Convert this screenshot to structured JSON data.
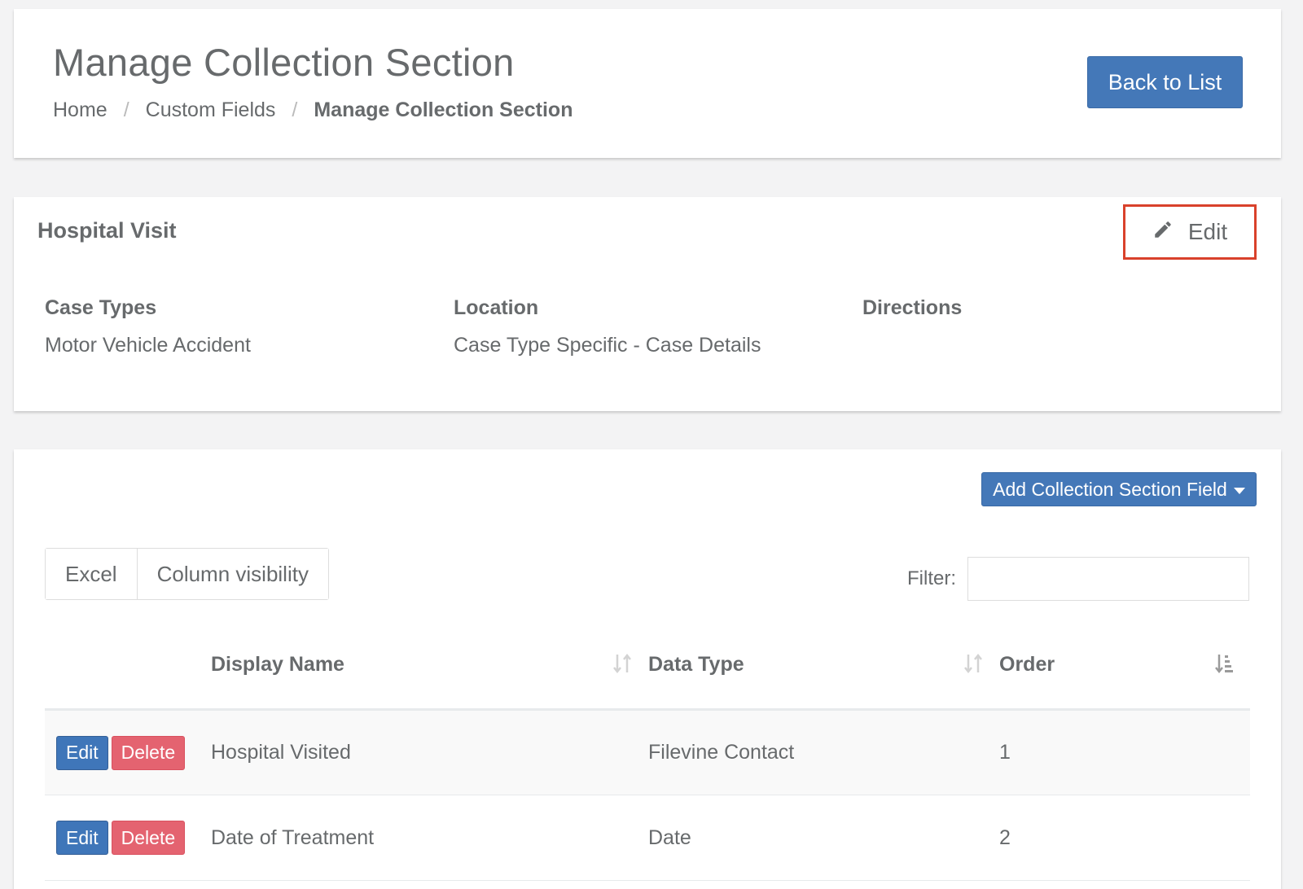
{
  "header": {
    "title": "Manage Collection Section",
    "breadcrumb": [
      "Home",
      "Custom Fields",
      "Manage Collection Section"
    ],
    "breadcrumb_separator": "/",
    "back_label": "Back to List"
  },
  "section": {
    "name": "Hospital Visit",
    "edit_label": "Edit",
    "edit_icon": "pencil-icon",
    "highlight_color": "#d9412b",
    "info": [
      {
        "label": "Case Types",
        "value": "Motor Vehicle Accident"
      },
      {
        "label": "Location",
        "value": "Case Type Specific - Case Details"
      },
      {
        "label": "Directions",
        "value": ""
      }
    ]
  },
  "fields": {
    "add_label": "Add Collection Section Field",
    "export_buttons": [
      "Excel",
      "Column visibility"
    ],
    "filter_label": "Filter:",
    "filter_value": "",
    "columns": [
      "",
      "Display Name",
      "Data Type",
      "Order"
    ],
    "row_edit_label": "Edit",
    "row_delete_label": "Delete",
    "rows": [
      {
        "display_name": "Hospital Visited",
        "data_type": "Filevine Contact",
        "order": "1"
      },
      {
        "display_name": "Date of Treatment",
        "data_type": "Date",
        "order": "2"
      }
    ]
  },
  "colors": {
    "primary": "#4478b8",
    "danger": "#e46370",
    "text": "#676a6c",
    "background": "#f3f3f4"
  }
}
